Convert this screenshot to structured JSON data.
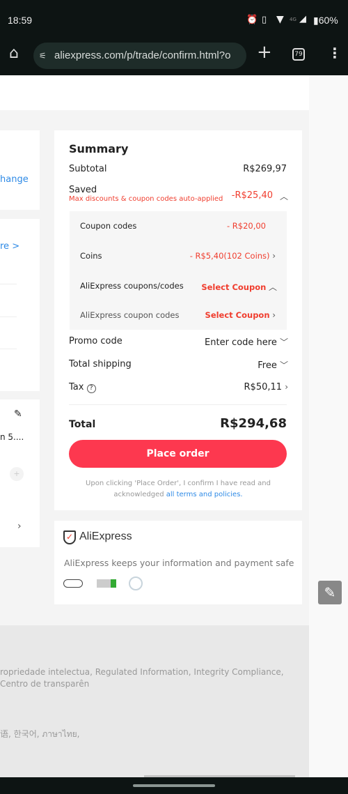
{
  "status": {
    "time": "18:59",
    "network": "4G",
    "battery": "60%"
  },
  "browser": {
    "url": "aliexpress.com/p/trade/confirm.html?o",
    "tab_count": "79"
  },
  "left_partial": {
    "change_link": "hange",
    "more_link": "re >",
    "item_text": "n 5...."
  },
  "summary": {
    "title": "Summary",
    "subtotal_label": "Subtotal",
    "subtotal_value": "R$269,97",
    "saved_label": "Saved",
    "saved_note": "Max discounts & coupon codes auto-applied",
    "saved_value": "-R$25,40",
    "coupon_codes_label": "Coupon codes",
    "coupon_codes_value": "- R$20,00",
    "coins_label": "Coins",
    "coins_value": "- R$5,40(102 Coins)",
    "ae_coupons_label": "AliExpress coupons/codes",
    "ae_coupons_value": "Select Coupon",
    "ae_coupon_codes_label": "AliExpress coupon codes",
    "ae_coupon_codes_value": "Select Coupon",
    "promo_label": "Promo code",
    "promo_value": "Enter code here",
    "shipping_label": "Total shipping",
    "shipping_value": "Free",
    "tax_label": "Tax",
    "tax_value": "R$50,11",
    "total_label": "Total",
    "total_value": "R$294,68",
    "place_order": "Place order",
    "terms_text": "Upon clicking 'Place Order', I confirm I have read and acknowledged ",
    "terms_link": "all terms and policies."
  },
  "secure": {
    "brand": "AliExpress",
    "text": "AliExpress keeps your information and payment safe"
  },
  "footer": {
    "links": "ropriedade intelectua, Regulated Information, Integrity Compliance, Centro de transparên",
    "languages": "语, 한국어, ภาษาไทย,"
  },
  "colors": {
    "accent": "#fd384f",
    "discount": "#f03d2e",
    "link": "#2e8ae6"
  }
}
